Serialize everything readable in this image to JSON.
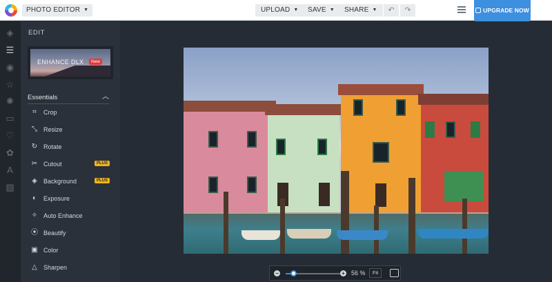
{
  "topbar": {
    "app_menu": "PHOTO EDITOR",
    "upload": "UPLOAD",
    "save": "SAVE",
    "share": "SHARE",
    "undo_icon": "undo-icon",
    "redo_icon": "redo-icon",
    "upgrade": "UPGRADE NOW"
  },
  "panel": {
    "title": "EDIT",
    "promo_label": "ENHANCE DLX",
    "promo_badge": "New",
    "section": "Essentials",
    "tools": [
      {
        "label": "Crop",
        "icon": "crop-icon"
      },
      {
        "label": "Resize",
        "icon": "resize-icon"
      },
      {
        "label": "Rotate",
        "icon": "rotate-icon"
      },
      {
        "label": "Cutout",
        "icon": "scissors-icon",
        "badge": "PLUS"
      },
      {
        "label": "Background",
        "icon": "background-icon",
        "badge": "PLUS"
      },
      {
        "label": "Exposure",
        "icon": "exposure-icon"
      },
      {
        "label": "Auto Enhance",
        "icon": "magic-wand-icon"
      },
      {
        "label": "Beautify",
        "icon": "beautify-icon"
      },
      {
        "label": "Color",
        "icon": "color-icon"
      },
      {
        "label": "Sharpen",
        "icon": "sharpen-icon"
      }
    ]
  },
  "zoom": {
    "value_percent": 56,
    "value_text": "56 %",
    "fit": "Fit"
  },
  "colors": {
    "accent": "#3d8fe0",
    "plus_badge": "#f0b51a",
    "new_badge": "#e03a3a"
  }
}
